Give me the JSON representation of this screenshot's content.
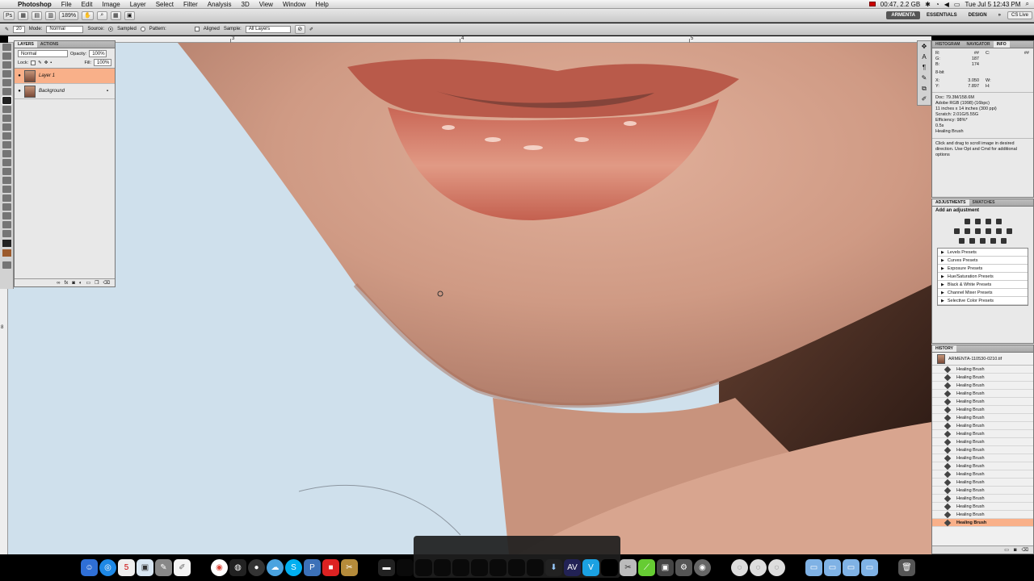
{
  "menubar": {
    "items": [
      "Photoshop",
      "File",
      "Edit",
      "Image",
      "Layer",
      "Select",
      "Filter",
      "Analysis",
      "3D",
      "View",
      "Window",
      "Help"
    ],
    "status_text": "00:47, 2.2 GB",
    "clock": "Tue Jul 5  12:43 PM"
  },
  "appbar": {
    "zoom": "189%",
    "workspaces": [
      "ARMENTA",
      "ESSENTIALS",
      "DESIGN"
    ],
    "more": "»",
    "cslive": "CS Live"
  },
  "options": {
    "brush_size": "20",
    "mode_label": "Mode:",
    "mode_value": "Normal",
    "source_label": "Source:",
    "sampled": "Sampled",
    "pattern": "Pattern:",
    "aligned": "Aligned",
    "sample_label": "Sample:",
    "sample_value": "All Layers"
  },
  "ruler": {
    "labels": [
      "3",
      "4",
      "5"
    ],
    "v_label": "8"
  },
  "layers": {
    "tabs": [
      "LAYERS",
      "ACTIONS"
    ],
    "blend": "Normal",
    "opacity_label": "Opacity:",
    "opacity": "100%",
    "lock_label": "Lock:",
    "fill_label": "Fill:",
    "fill": "100%",
    "items": [
      {
        "name": "Layer 1",
        "selected": true
      },
      {
        "name": "Background",
        "selected": false
      }
    ]
  },
  "info": {
    "tabs": [
      "HISTOGRAM",
      "NAVIGATOR",
      "INFO"
    ],
    "r_label": "R:",
    "r": "##",
    "g_label": "G:",
    "g": "187",
    "b_label": "B:",
    "b": "174",
    "x_label": "X:",
    "x": "3.050",
    "y_label": "Y:",
    "y": "7.897",
    "c_label": "C:",
    "c": "##",
    "bit": "8-bit",
    "w_label": "W:",
    "h_label": "H:",
    "doc": "Doc: 79.3M/158.6M",
    "profile": "Adobe RGB (1998) (16bpc)",
    "size": "11 inches x 14 inches (300 ppi)",
    "scratch": "Scratch: 2.01G/5.55G",
    "efficiency": "Efficiency: 98%*",
    "timing": "0.5s",
    "tool": "Healing Brush",
    "hint": "Click and drag to scroll image in desired direction.  Use Opt and Cmd for additional options"
  },
  "adjustments": {
    "tabs": [
      "ADJUSTMENTS",
      "SWATCHES"
    ],
    "title": "Add an adjustment",
    "presets": [
      "Levels Presets",
      "Curves Presets",
      "Exposure Presets",
      "Hue/Saturation Presets",
      "Black & White Presets",
      "Channel Mixer Presets",
      "Selective Color Presets"
    ]
  },
  "history": {
    "tab": "HISTORY",
    "snapshot": "ARMENTA-110530-0210.tif",
    "step_label": "Healing Brush",
    "step_count": 20
  },
  "colors": {
    "accent": "#f9b089",
    "skin": "#d5a08a",
    "lips": "#d06f5e",
    "background": "#cfe0ec"
  }
}
